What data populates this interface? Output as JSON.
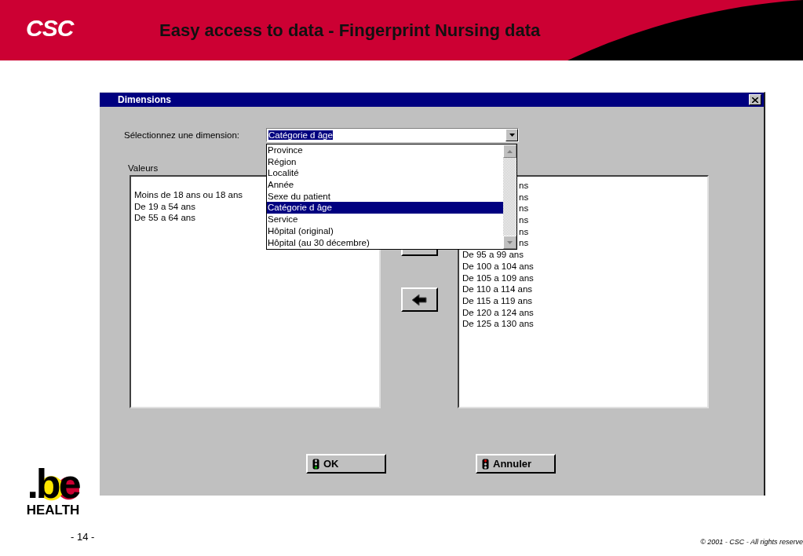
{
  "slide": {
    "logo": "CSC",
    "title": "Easy access to data - Fingerprint Nursing data",
    "brand_mark": ".be",
    "brand_caption": "HEALTH",
    "page_number": "- 14 -",
    "footer": "© 2001 - CSC  -  All rights reserve"
  },
  "dialog": {
    "title": "Dimensions",
    "prompt": "Sélectionnez une dimension:",
    "combo": {
      "value": "Catégorie d âge",
      "options": [
        {
          "label": "Province",
          "selected": false
        },
        {
          "label": "Région",
          "selected": false
        },
        {
          "label": "Localité",
          "selected": false
        },
        {
          "label": "Année",
          "selected": false
        },
        {
          "label": "Sexe du patient",
          "selected": false
        },
        {
          "label": "Catégorie d âge",
          "selected": true
        },
        {
          "label": "Service",
          "selected": false
        },
        {
          "label": "Hôpital (original)",
          "selected": false
        },
        {
          "label": "Hôpital (au 30 décembre)",
          "selected": false
        }
      ]
    },
    "values_label": "Valeurs",
    "available_values": [
      "Moins de 18 ans ou 18 ans",
      "De 19 a 54 ans",
      "De 55 a 64 ans"
    ],
    "chosen_values": [
      {
        "text": "ns",
        "kind": "partial"
      },
      {
        "text": "ns",
        "kind": "partial"
      },
      {
        "text": "ns",
        "kind": "partial"
      },
      {
        "text": "ns",
        "kind": "partial"
      },
      {
        "text": "ns",
        "kind": "partial"
      },
      {
        "text": "ns",
        "kind": "partial"
      },
      {
        "text": "De 95 a 99 ans",
        "kind": "full"
      },
      {
        "text": "De 100 a 104 ans",
        "kind": "full"
      },
      {
        "text": "De 105 a 109 ans",
        "kind": "full"
      },
      {
        "text": "De 110 a 114 ans",
        "kind": "full"
      },
      {
        "text": "De 115 a 119 ans",
        "kind": "full"
      },
      {
        "text": "De 120 a 124 ans",
        "kind": "full"
      },
      {
        "text": "De 125 a 130 ans",
        "kind": "full"
      }
    ],
    "buttons": [
      {
        "label": "OK",
        "kind": "go"
      },
      {
        "label": "Annuler",
        "kind": "stop"
      }
    ]
  }
}
